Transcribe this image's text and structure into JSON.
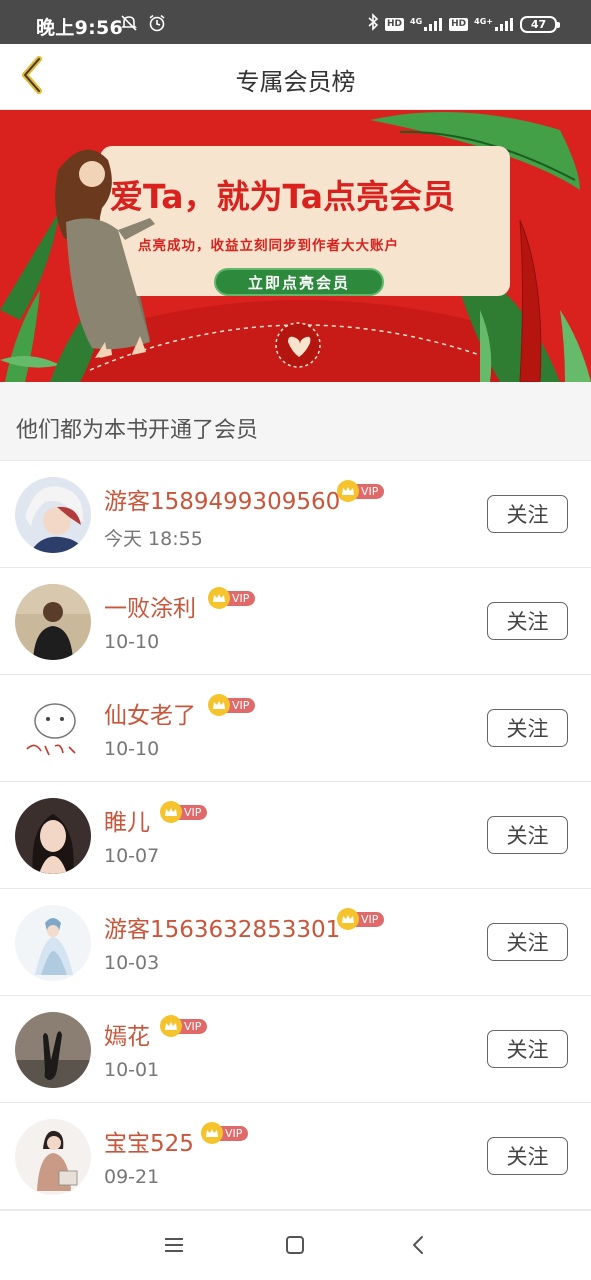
{
  "status_bar": {
    "time": "晚上9:56",
    "hd_label": "HD",
    "network_label": "4G",
    "network_label_plus": "4G+",
    "battery": "47"
  },
  "nav": {
    "title": "专属会员榜",
    "back_icon": "chevron-left-icon"
  },
  "banner": {
    "title": "爱Ta，就为Ta点亮会员",
    "subtitle": "点亮成功，收益立刻同步到作者大大账户",
    "cta": "立即点亮会员"
  },
  "section": {
    "heading": "他们都为本书开通了会员"
  },
  "vip_label": "VIP",
  "follow_label": "关注",
  "members": [
    {
      "name": "游客1589499309560",
      "date": "今天 18:55"
    },
    {
      "name": "一败涂利",
      "date": "10-10"
    },
    {
      "name": "仙女老了",
      "date": "10-10"
    },
    {
      "name": "睢儿",
      "date": "10-07"
    },
    {
      "name": "游客1563632853301",
      "date": "10-03"
    },
    {
      "name": "嫣花",
      "date": "10-01"
    },
    {
      "name": "宝宝525",
      "date": "09-21"
    }
  ],
  "colors": {
    "banner_red": "#d9221d",
    "name_color": "#c9553a",
    "vip_red": "#e06a6a",
    "crown_gold": "#f5c32c",
    "cta_green": "#2d8a3c"
  },
  "system_nav": {
    "menu_icon": "menu-icon",
    "home_icon": "home-square-icon",
    "back_icon": "back-chevron-icon"
  }
}
